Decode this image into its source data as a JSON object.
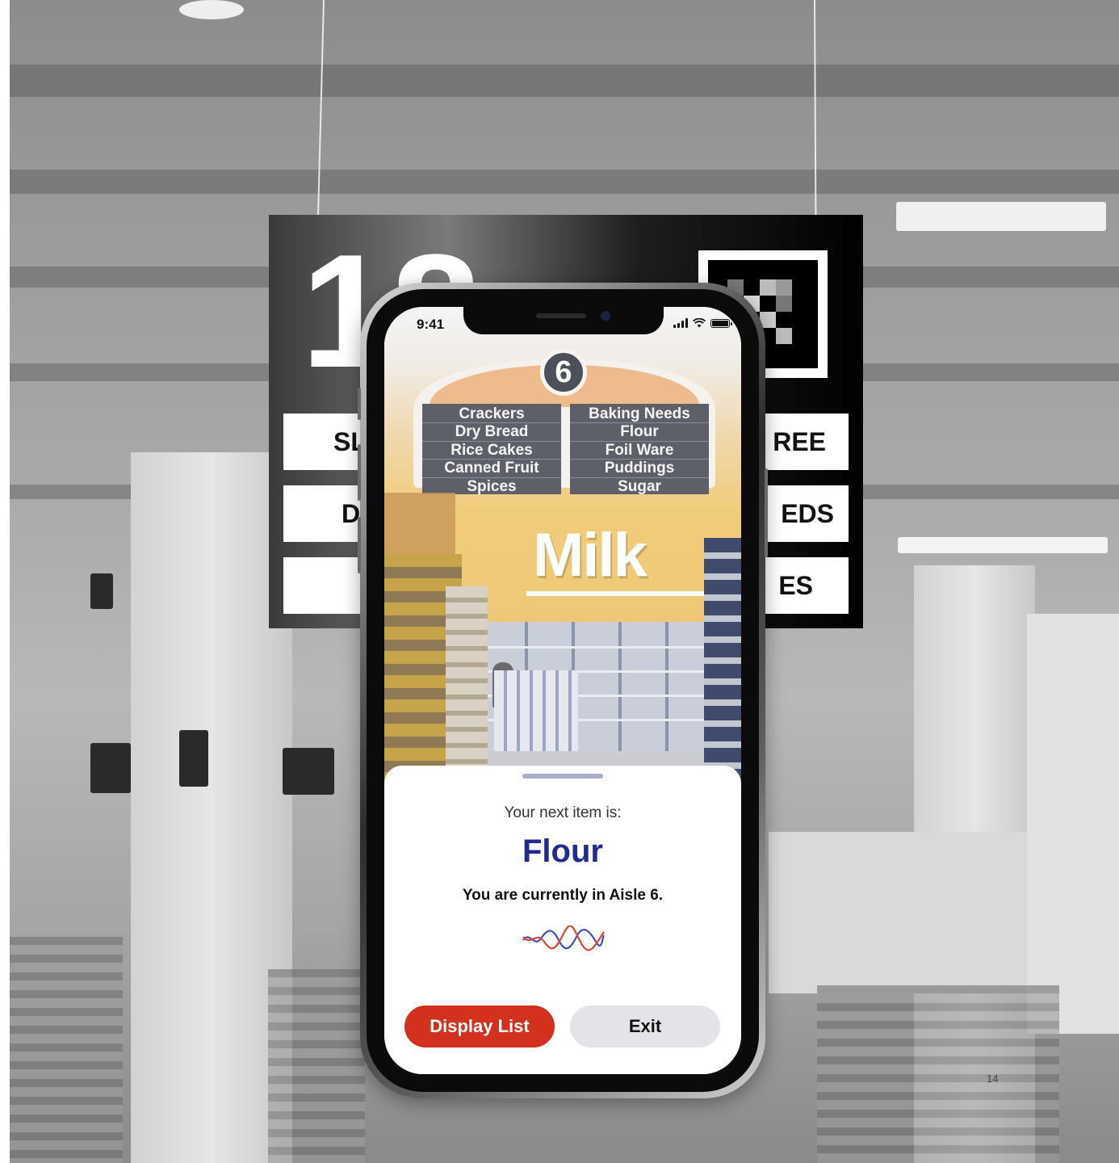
{
  "background": {
    "aisle_sign": {
      "number": "18",
      "rows": [
        {
          "left": "SL",
          "right": "REE"
        },
        {
          "left": "D",
          "right": "EDS"
        },
        {
          "left": "",
          "right": "ES"
        }
      ]
    }
  },
  "phone": {
    "status_bar": {
      "time": "9:41",
      "icons": [
        "cellular-signal-icon",
        "wifi-icon",
        "battery-icon"
      ]
    },
    "camera_view": {
      "aisle_badge": "6",
      "left_panel": [
        "Crackers",
        "Dry Bread",
        "Rice Cakes",
        "Canned Fruit",
        "Spices"
      ],
      "right_panel": [
        "Baking Needs",
        "Flour",
        "Foil Ware",
        "Puddings",
        "Sugar"
      ],
      "wall_sign": "Milk"
    },
    "sheet": {
      "next_label": "Your next item is:",
      "item_name": "Flour",
      "location": "You are currently in Aisle 6.",
      "voice_icon": "voice-wave-icon",
      "display_list_label": "Display List",
      "exit_label": "Exit"
    }
  },
  "colors": {
    "accent_red": "#d2321d",
    "item_blue": "#212a8e",
    "exit_gray": "#e3e3e8",
    "grabber": "#a9afcd"
  },
  "page_number": "14"
}
